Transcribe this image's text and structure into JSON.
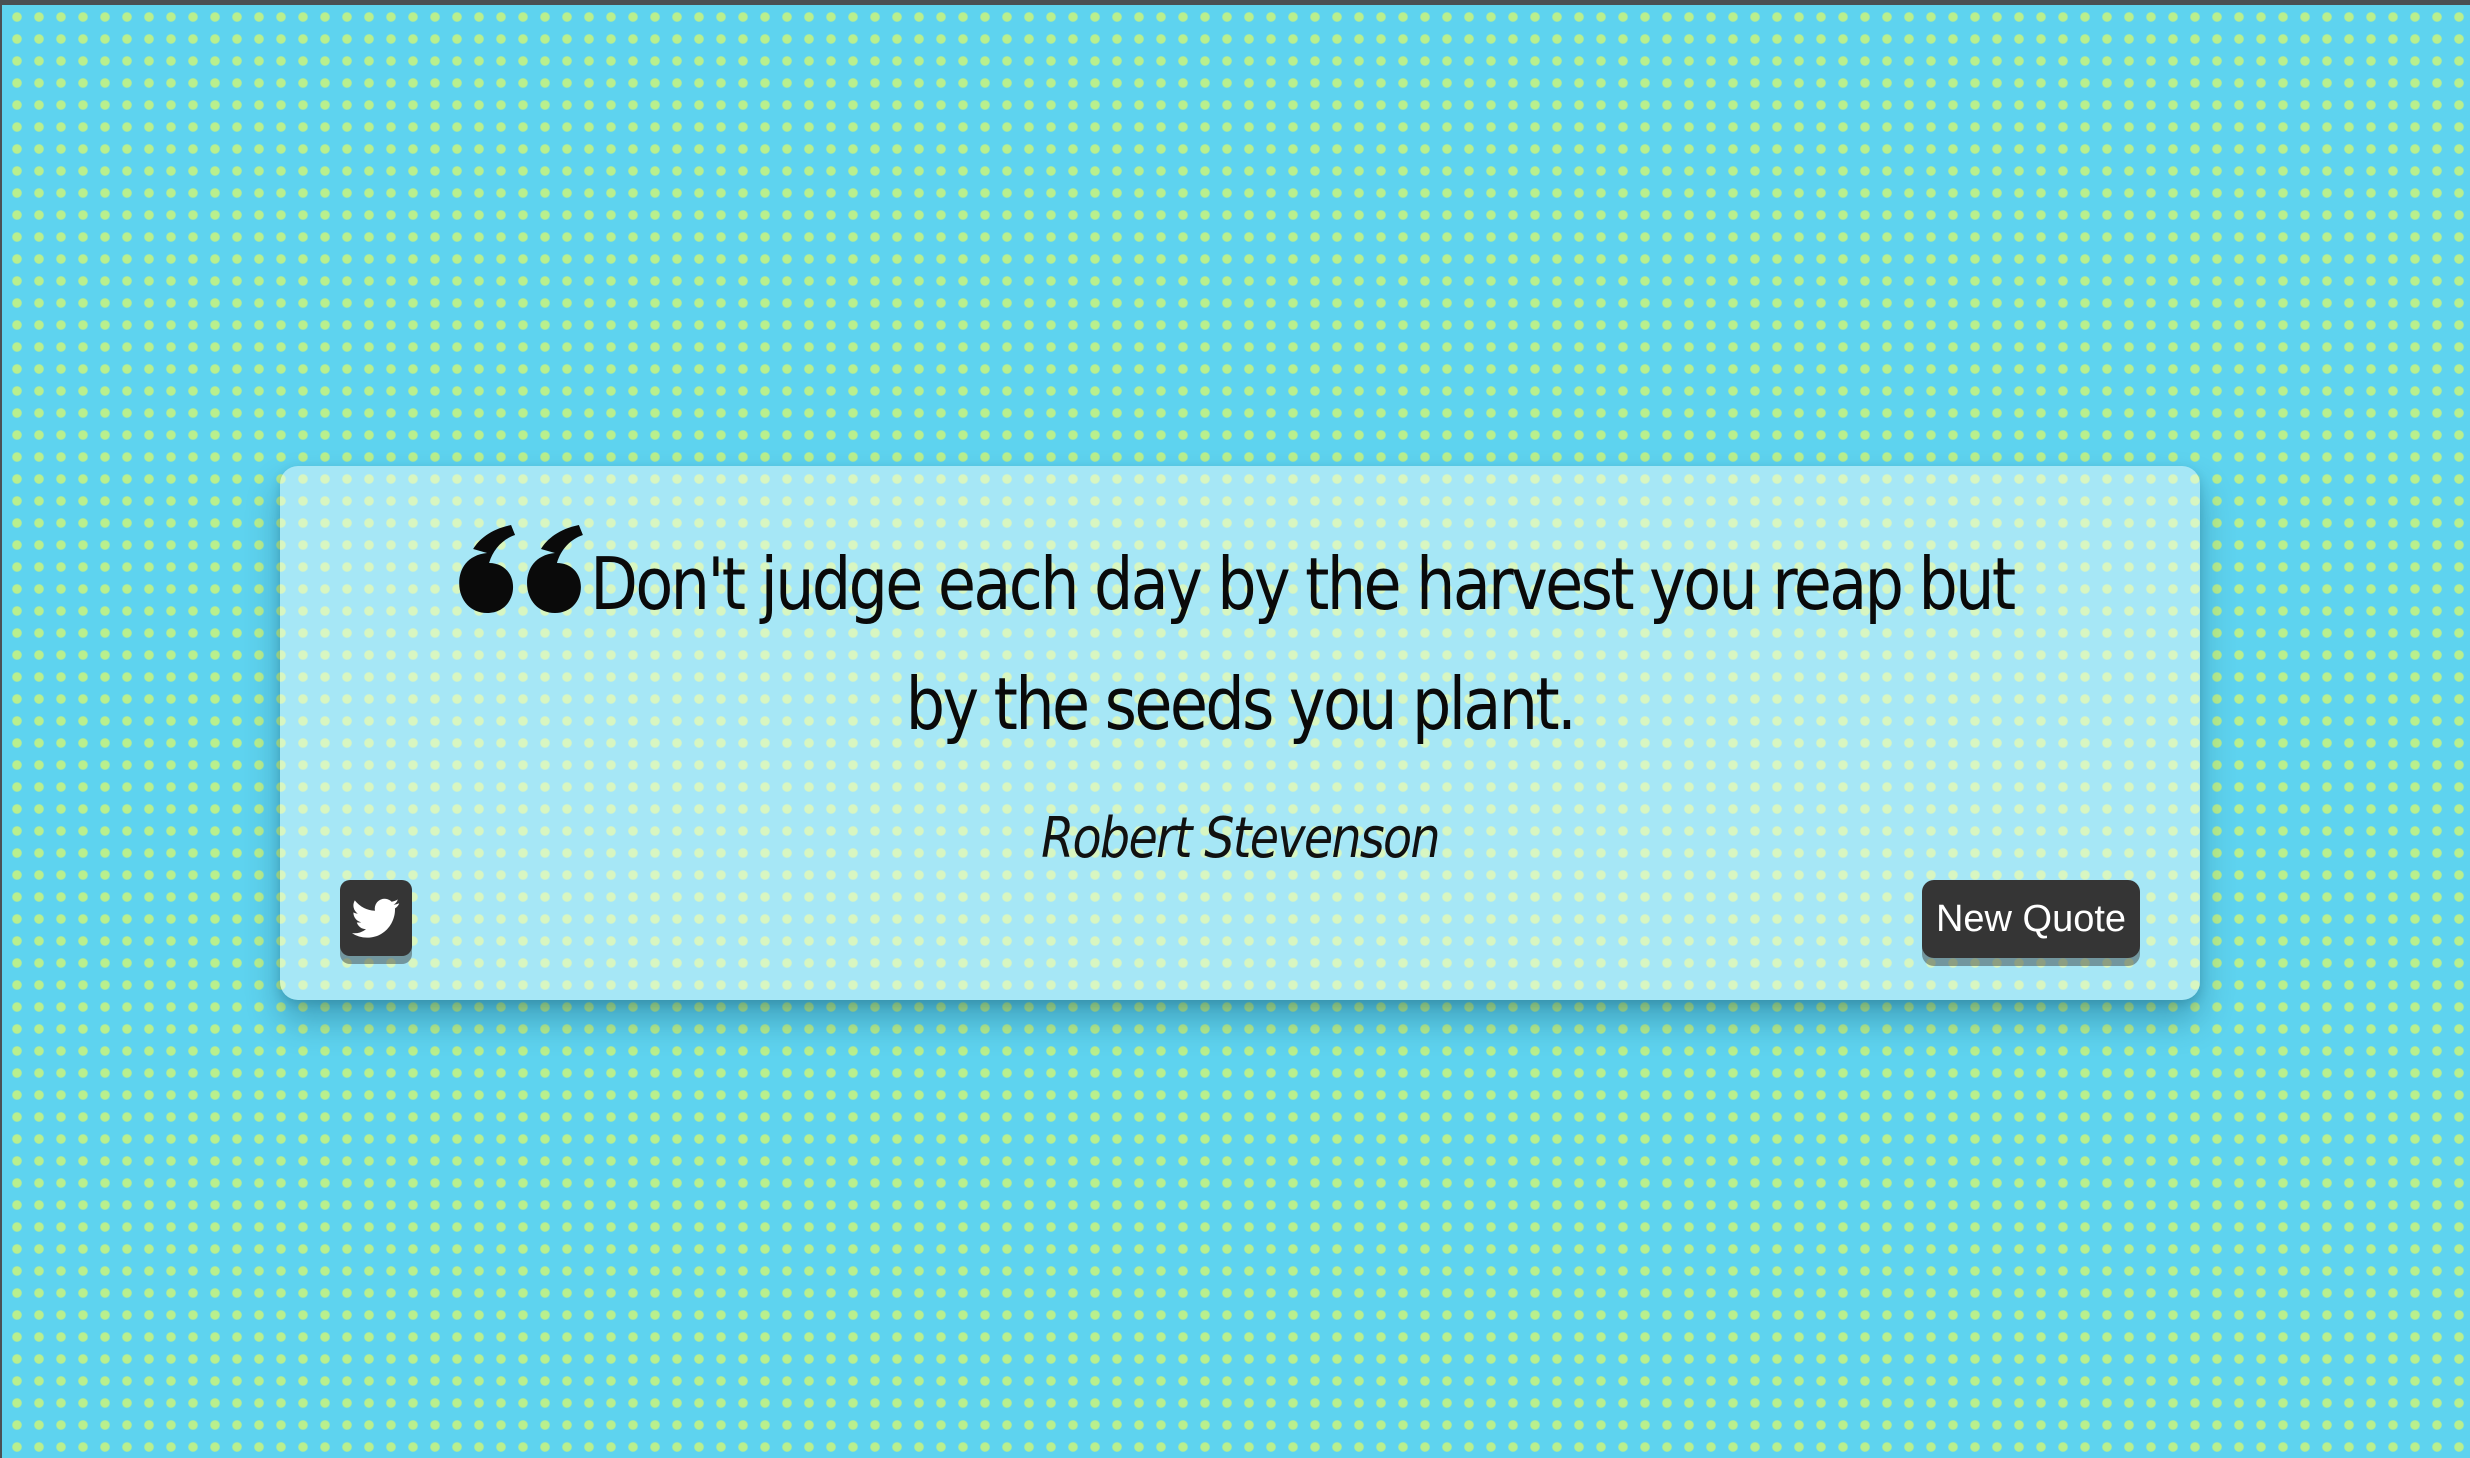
{
  "quote": {
    "text": "Don't judge each day by the harvest you reap but by the seeds you plant.",
    "author": "Robert Stevenson",
    "icon": "quote-left-icon"
  },
  "actions": {
    "tweet_icon": "twitter-icon",
    "new_quote_label": "New Quote"
  },
  "colors": {
    "background": "#5ed3ef",
    "dots": "#b9ef8e",
    "button": "#353535",
    "button_text": "#ffffff",
    "text": "#0a0a0a"
  }
}
